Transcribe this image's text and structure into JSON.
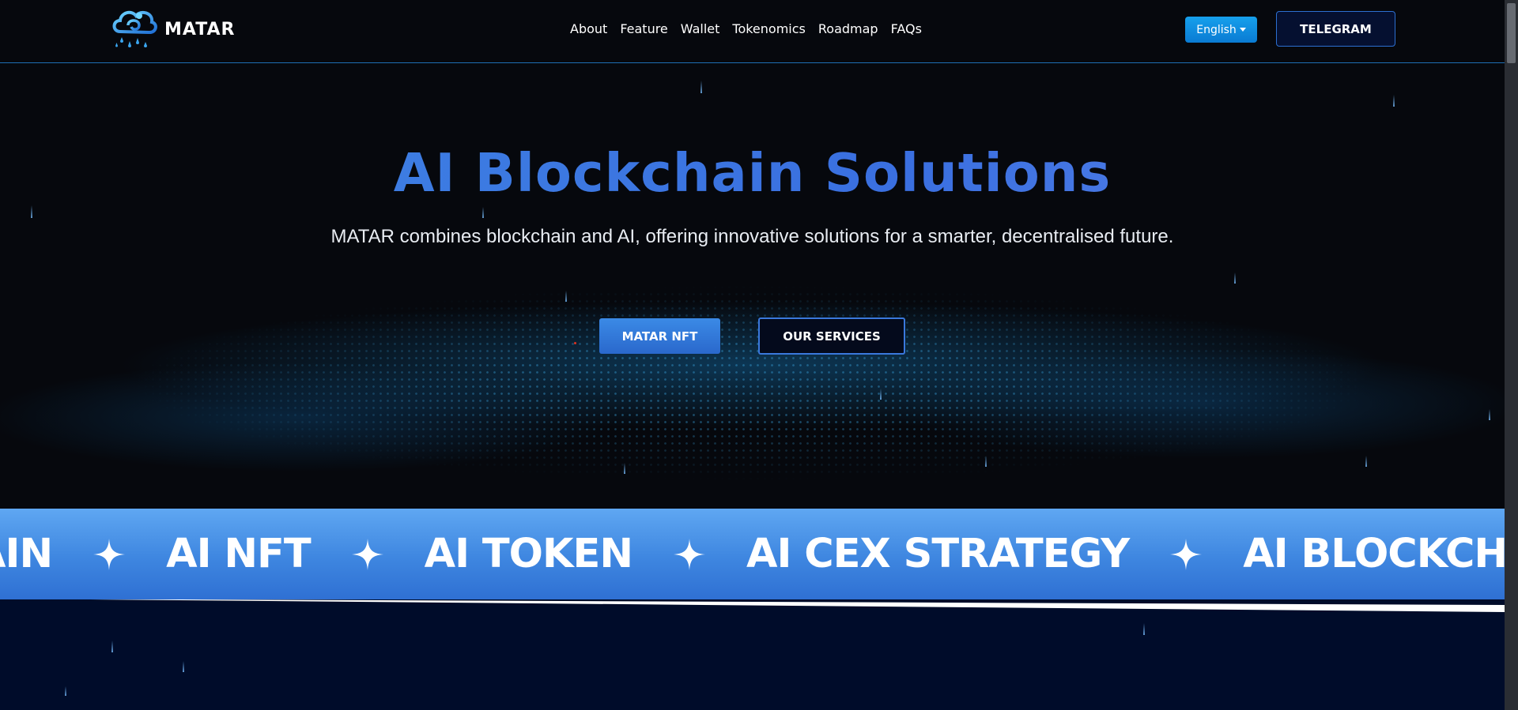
{
  "brand": {
    "name": "MATAR",
    "logo_icon": "cloud-rain-logo-icon"
  },
  "nav": {
    "items": [
      {
        "label": "About"
      },
      {
        "label": "Feature"
      },
      {
        "label": "Wallet"
      },
      {
        "label": "Tokenomics"
      },
      {
        "label": "Roadmap"
      },
      {
        "label": "FAQs"
      }
    ]
  },
  "header": {
    "language_label": "English",
    "telegram_label": "TELEGRAM"
  },
  "hero": {
    "title": "AI Blockchain Solutions",
    "subtitle": "MATAR combines blockchain and AI, offering innovative solutions for a smarter, decentralised future.",
    "primary_button": "MATAR NFT",
    "secondary_button": "OUR SERVICES"
  },
  "marquee": {
    "items": [
      "AIN",
      "AI NFT",
      "AI TOKEN",
      "AI CEX STRATEGY",
      "AI BLOCKCHAIN"
    ],
    "separator_icon": "four-point-star-icon"
  },
  "colors": {
    "background": "#06080d",
    "accent": "#3f86e3",
    "marquee_band": "#4a90e6",
    "bottom_section": "#000c2a"
  }
}
